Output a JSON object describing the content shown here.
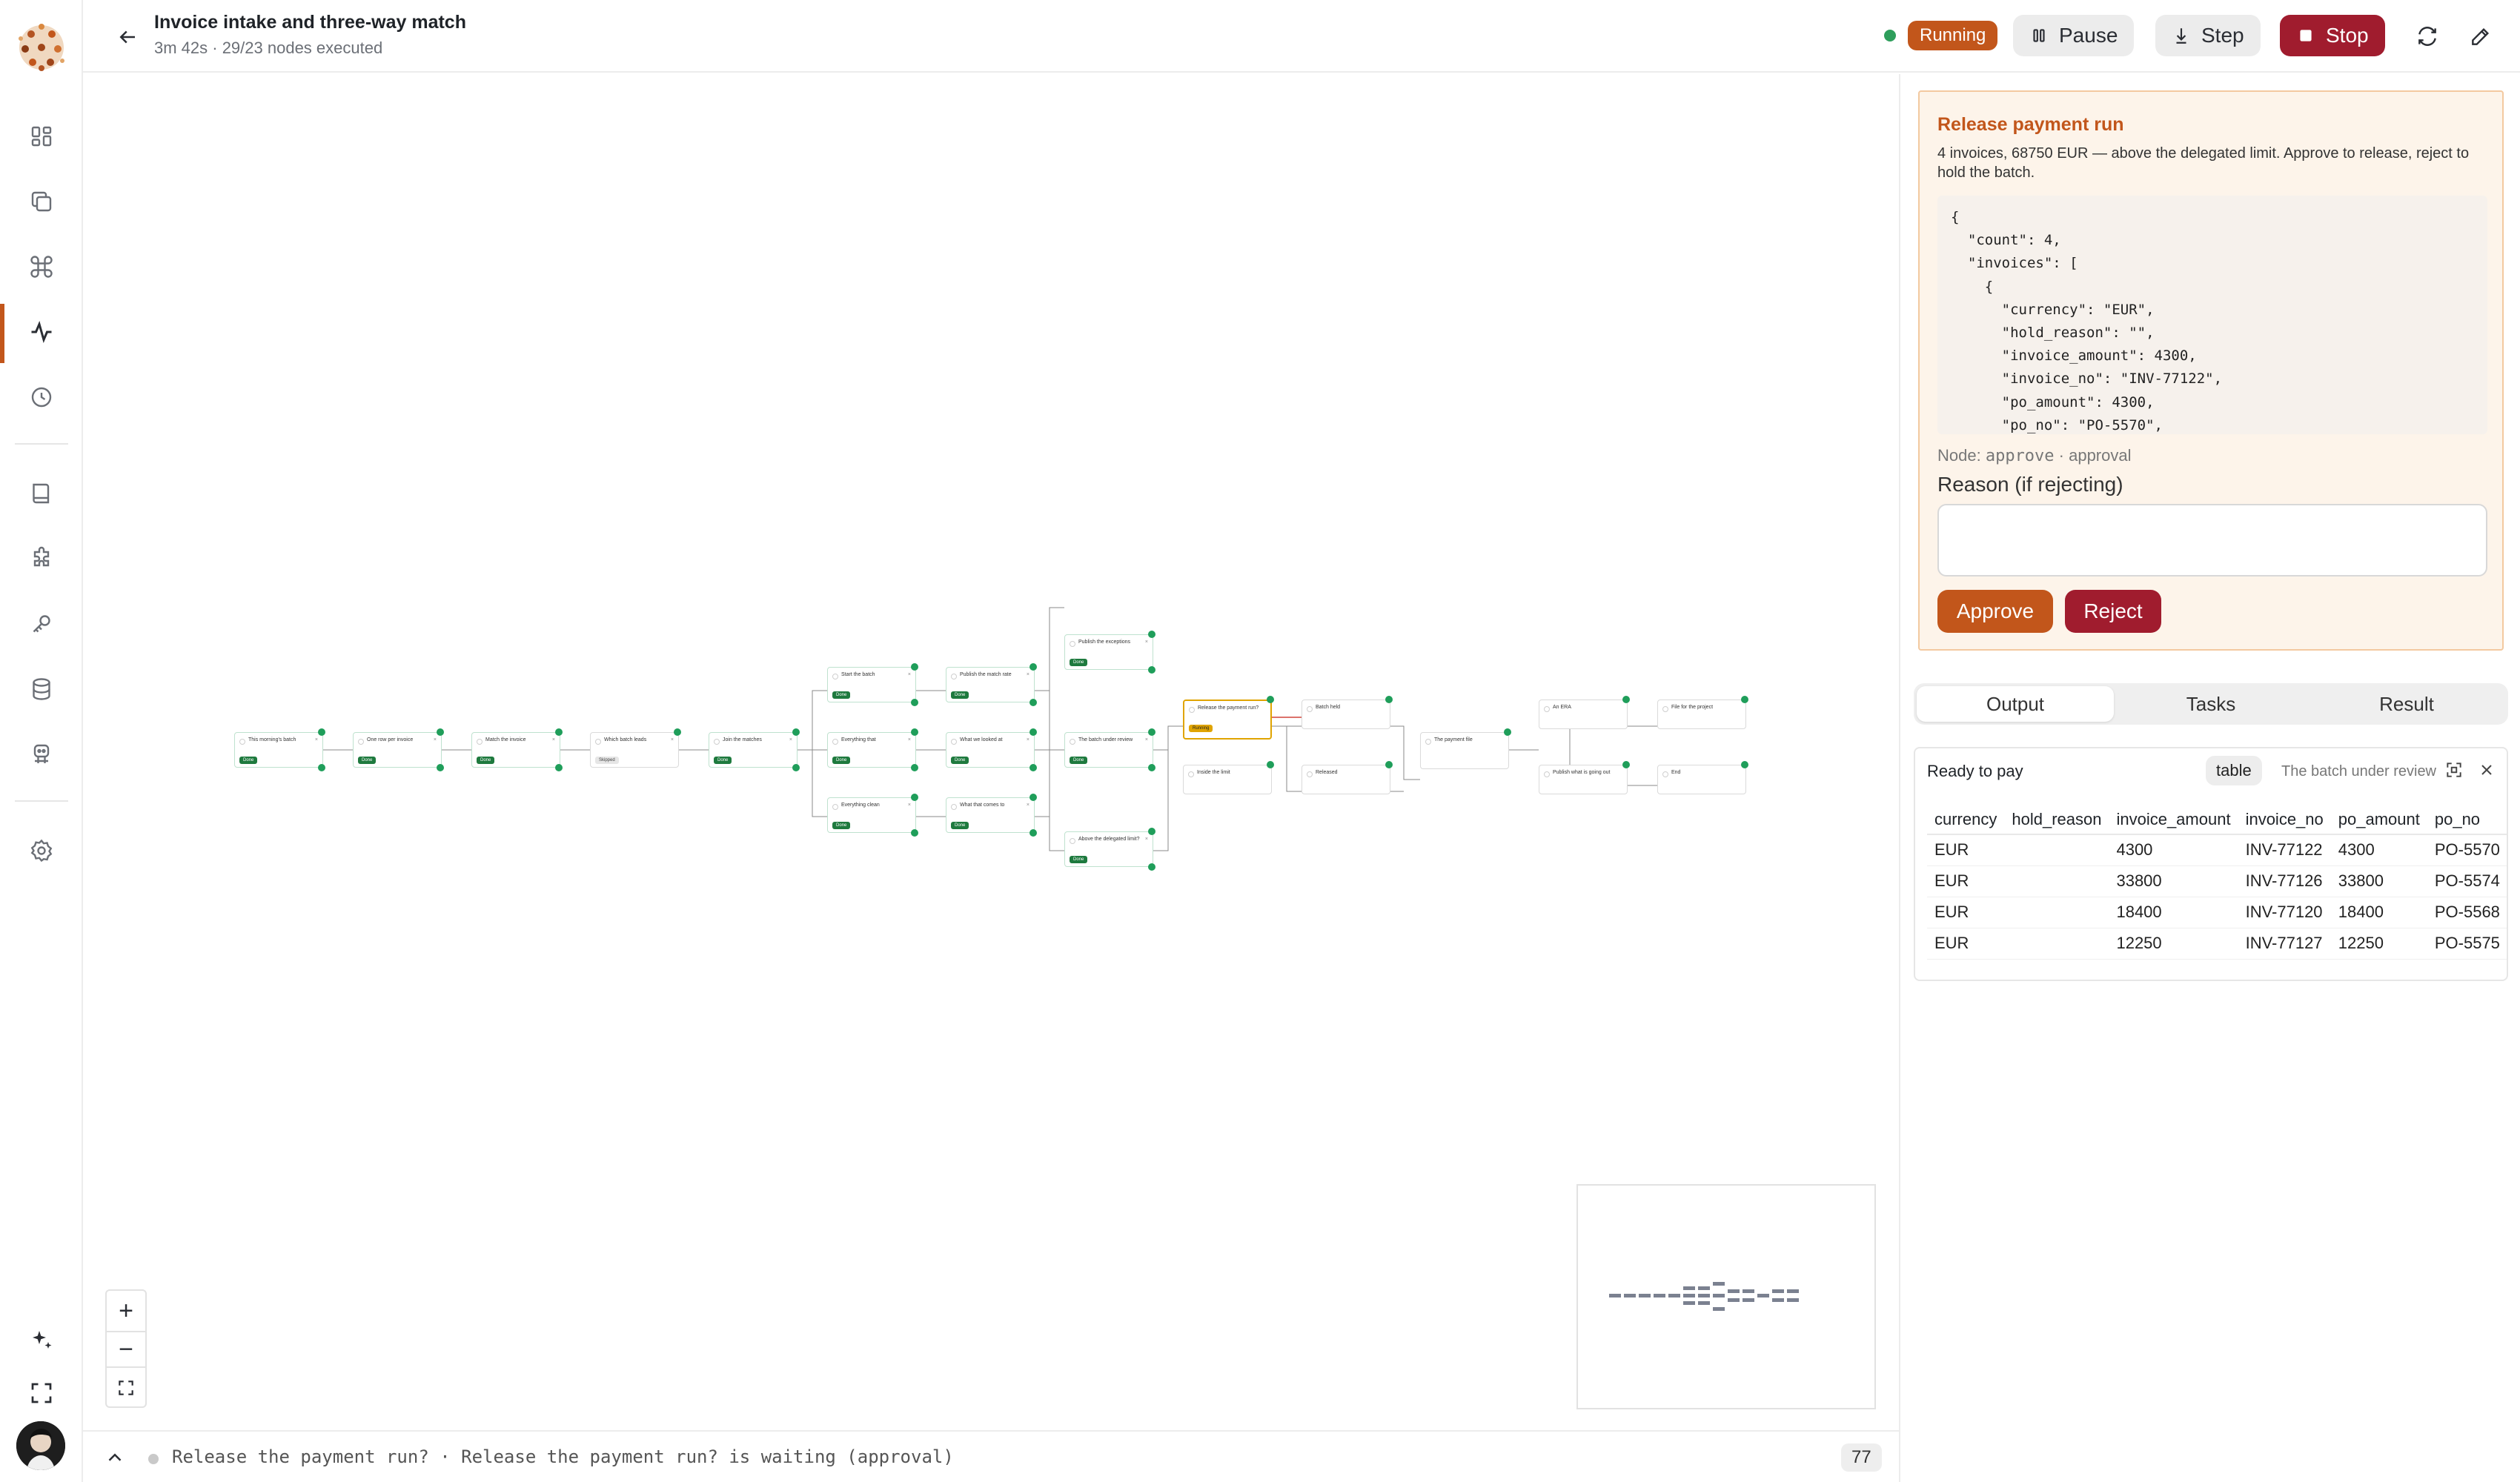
{
  "header": {
    "title": "Invoice intake and three-way match",
    "subtitle": "3m 42s · 29/23 nodes executed",
    "status": "Running",
    "pause_label": "Pause",
    "step_label": "Step",
    "stop_label": "Stop"
  },
  "colors": {
    "accent": "#c2561b",
    "danger": "#a01c2e",
    "success": "#1e7a3e",
    "running_dot": "#2e9e5b"
  },
  "approval": {
    "title": "Release payment run",
    "description": "4 invoices, 68750 EUR — above the delegated limit. Approve to release, reject to hold the batch.",
    "payload": "{\n  \"count\": 4,\n  \"invoices\": [\n    {\n      \"currency\": \"EUR\",\n      \"hold_reason\": \"\",\n      \"invoice_amount\": 4300,\n      \"invoice_no\": \"INV-77122\",\n      \"po_amount\": 4300,\n      \"po_no\": \"PO-5570\",",
    "node_prefix": "Node: ",
    "node_id": "approve",
    "node_type": " · approval",
    "reason_label": "Reason (if rejecting)",
    "reason_value": "",
    "approve_label": "Approve",
    "reject_label": "Reject"
  },
  "tabs": [
    {
      "label": "Output",
      "active": true
    },
    {
      "label": "Tasks",
      "active": false
    },
    {
      "label": "Result",
      "active": false
    }
  ],
  "output": {
    "title": "Ready to pay",
    "view_mode": "table",
    "caption": "The batch under review",
    "columns": [
      "currency",
      "hold_reason",
      "invoice_amount",
      "invoice_no",
      "po_amount",
      "po_no"
    ],
    "rows": [
      [
        "EUR",
        "",
        "4300",
        "INV-77122",
        "4300",
        "PO-5570"
      ],
      [
        "EUR",
        "",
        "33800",
        "INV-77126",
        "33800",
        "PO-5574"
      ],
      [
        "EUR",
        "",
        "18400",
        "INV-77120",
        "18400",
        "PO-5568"
      ],
      [
        "EUR",
        "",
        "12250",
        "INV-77127",
        "12250",
        "PO-5575"
      ]
    ]
  },
  "workflow": {
    "nodes": [
      {
        "title": "This morning's batch",
        "status": "Done"
      },
      {
        "title": "One row per invoice",
        "status": "Done"
      },
      {
        "title": "Match the invoice",
        "status": "Done"
      },
      {
        "title": "Which batch leads",
        "status": "Skipped"
      },
      {
        "title": "Join the matches",
        "status": "Done"
      },
      {
        "title": "Start the batch",
        "status": "Done"
      },
      {
        "title": "Publish the match rate",
        "status": "Done"
      },
      {
        "title": "Publish the exceptions",
        "status": "Done"
      },
      {
        "title": "Everything that",
        "status": "Done"
      },
      {
        "title": "What we looked at",
        "status": "Done"
      },
      {
        "title": "The batch under review",
        "status": "Done"
      },
      {
        "title": "Everything clean",
        "status": "Done"
      },
      {
        "title": "What that comes to",
        "status": "Done"
      },
      {
        "title": "Above the delegated limit?",
        "status": "Done"
      },
      {
        "title": "Release the payment run?",
        "status": "Running"
      },
      {
        "title": "Batch held",
        "status": ""
      },
      {
        "title": "Inside the limit",
        "status": ""
      },
      {
        "title": "Released",
        "status": ""
      },
      {
        "title": "The payment file",
        "status": ""
      },
      {
        "title": "An ERA",
        "status": ""
      },
      {
        "title": "File for the project",
        "status": ""
      },
      {
        "title": "Publish what is going out",
        "status": ""
      },
      {
        "title": "End",
        "status": ""
      }
    ]
  },
  "bottombar": {
    "text": "Release the payment run? · Release the payment run? is waiting (approval)",
    "count": "77"
  }
}
